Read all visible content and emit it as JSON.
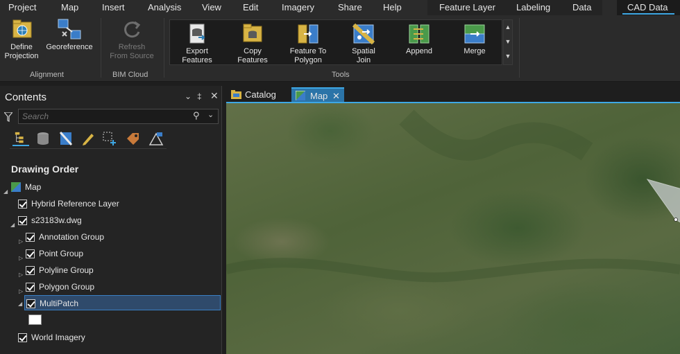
{
  "ribbon_tabs": [
    "Project",
    "Map",
    "Insert",
    "Analysis",
    "View",
    "Edit",
    "Imagery",
    "Share",
    "Help"
  ],
  "context_tabs": [
    "Feature Layer",
    "Labeling",
    "Data"
  ],
  "active_context_tab": "CAD Data",
  "alignment_group": {
    "label": "Alignment",
    "define_projection": [
      "Define",
      "Projection"
    ],
    "georeference": "Georeference"
  },
  "bim_group": {
    "label": "BIM Cloud",
    "refresh": [
      "Refresh",
      "From Source"
    ]
  },
  "tools_group": {
    "label": "Tools",
    "items": [
      [
        "Export",
        "Features"
      ],
      [
        "Copy",
        "Features"
      ],
      [
        "Feature To",
        "Polygon"
      ],
      [
        "Spatial",
        "Join"
      ],
      [
        "Append",
        ""
      ],
      [
        "Merge",
        ""
      ]
    ]
  },
  "contents": {
    "title": "Contents",
    "search_placeholder": "Search",
    "section_title": "Drawing Order",
    "layers": [
      "Map",
      "Hybrid Reference Layer",
      "s23183w.dwg",
      "Annotation Group",
      "Point Group",
      "Polyline Group",
      "Polygon Group",
      "MultiPatch",
      "World Imagery"
    ]
  },
  "doc_tabs": {
    "catalog": "Catalog",
    "map": "Map"
  },
  "colors": {
    "accent": "#3ea8e5",
    "selected_row": "#2f4a6b",
    "active_tab": "#2b74a8"
  }
}
